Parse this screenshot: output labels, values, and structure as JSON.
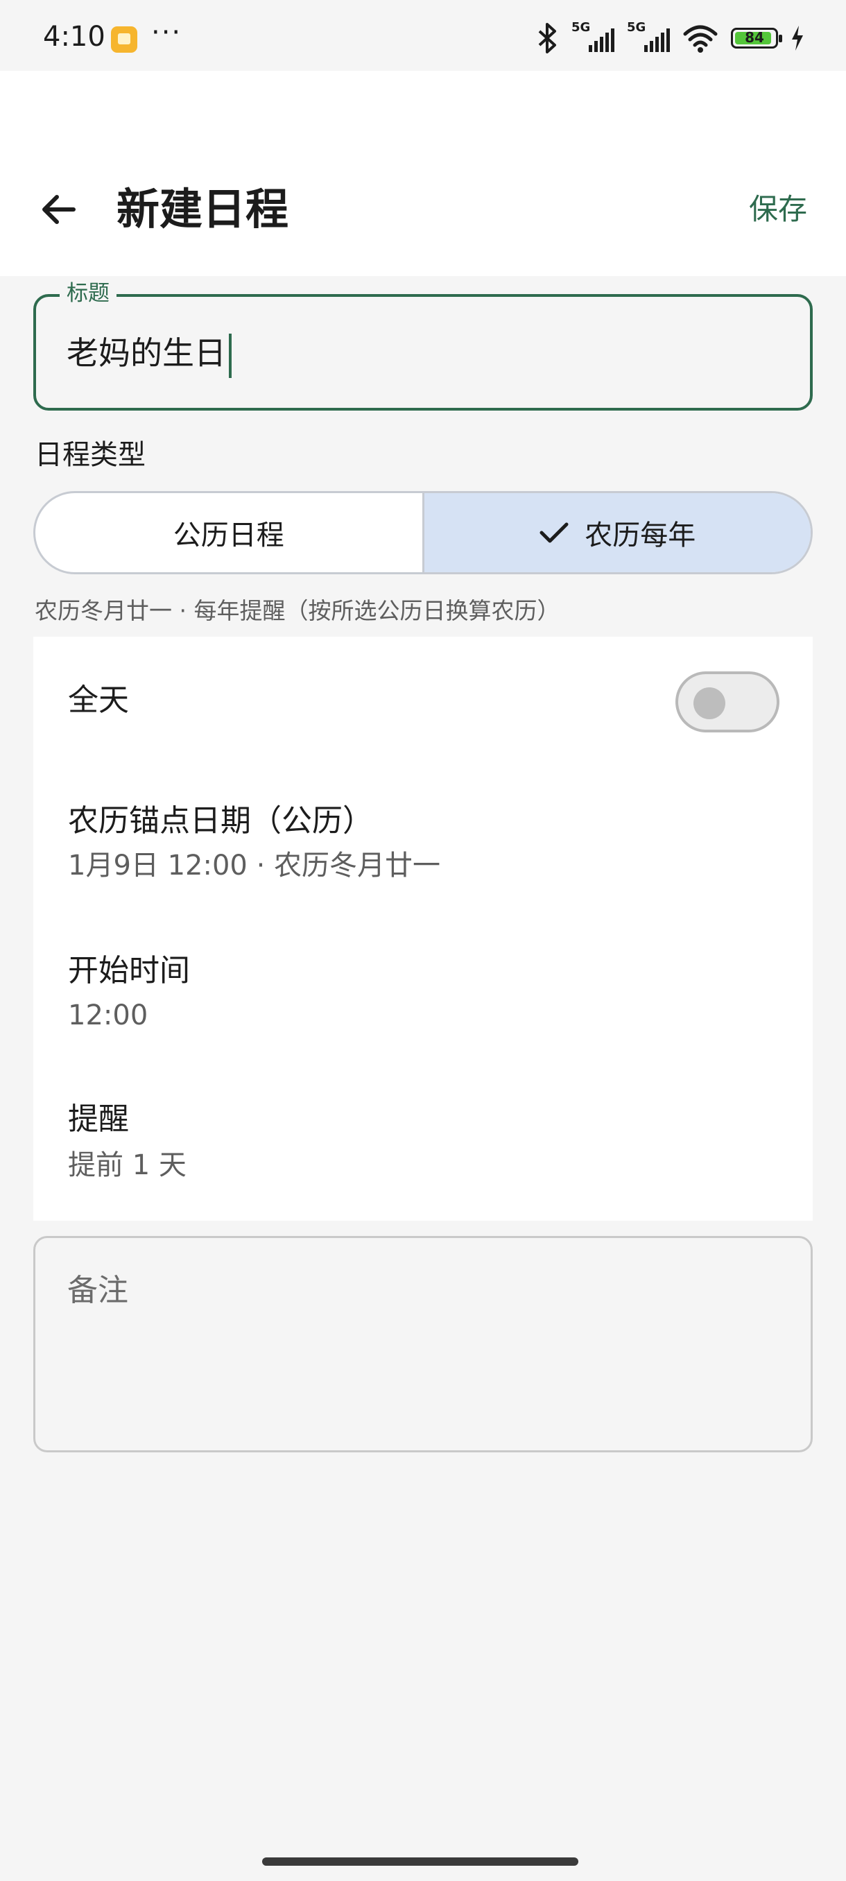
{
  "status_bar": {
    "time": "4:10",
    "dots": "···",
    "signal1_label": "5G",
    "signal2_label": "5G",
    "battery_level": "84",
    "icons": [
      "app-notification-icon",
      "bluetooth-icon",
      "signal-icon",
      "wifi-icon",
      "battery-icon",
      "charging-icon"
    ]
  },
  "header": {
    "title": "新建日程",
    "save_label": "保存"
  },
  "title_field": {
    "label": "标题",
    "value": "老妈的生日"
  },
  "schedule_type": {
    "label": "日程类型",
    "options": [
      "公历日程",
      "农历每年"
    ],
    "selected": "农历每年",
    "hint": "农历冬月廿一 · 每年提醒（按所选公历日换算农历）"
  },
  "card": {
    "all_day": {
      "label": "全天",
      "on": false
    },
    "anchor_date": {
      "label": "农历锚点日期（公历）",
      "value": "1月9日 12:00 · 农历冬月廿一"
    },
    "start_time": {
      "label": "开始时间",
      "value": "12:00"
    },
    "reminder": {
      "label": "提醒",
      "value": "提前 1 天"
    }
  },
  "notes": {
    "placeholder": "备注"
  },
  "colors": {
    "accent": "#2e6b4e",
    "selected_segment": "#d6e2f4",
    "background": "#f5f5f5"
  }
}
